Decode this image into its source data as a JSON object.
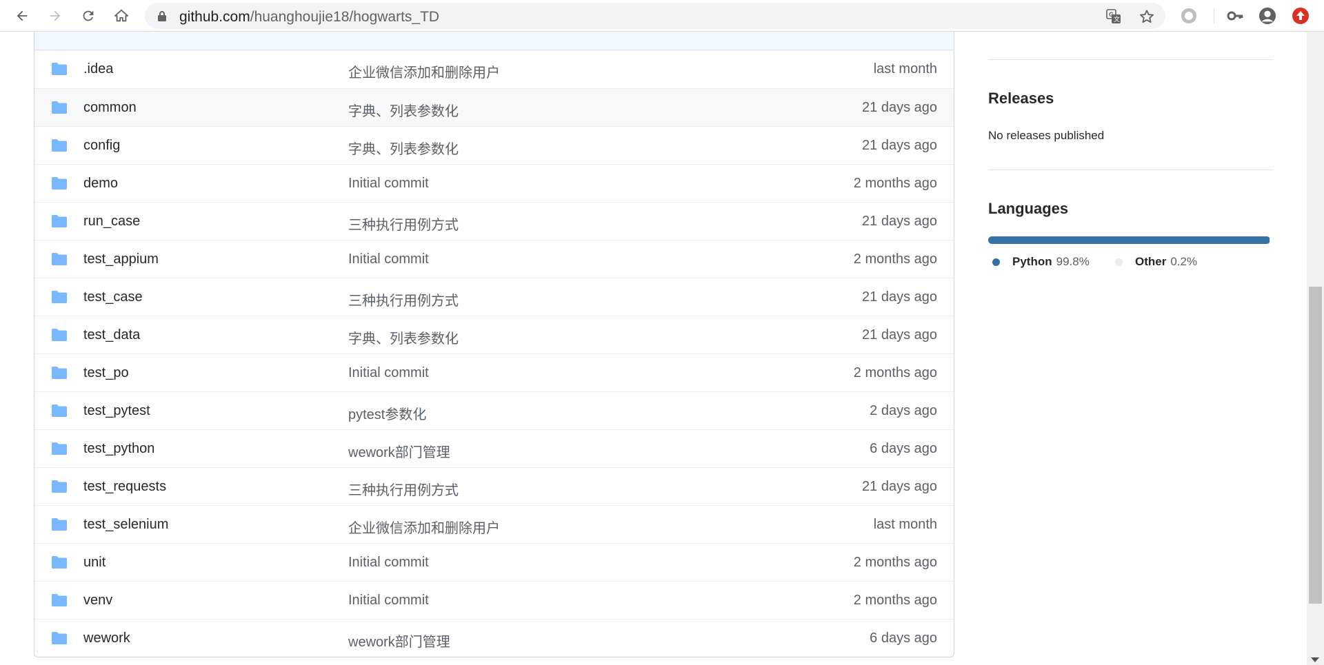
{
  "browser": {
    "url_host": "github.com",
    "url_path": "/huanghoujie18/hogwarts_TD",
    "icons": [
      "back-icon",
      "forward-icon",
      "reload-icon",
      "home-icon",
      "lock-icon",
      "translate-icon",
      "star-icon",
      "extension-icon",
      "key-icon",
      "profile-icon",
      "update-icon"
    ]
  },
  "files": [
    {
      "name": ".idea",
      "message": "企业微信添加和删除用户",
      "age": "last month"
    },
    {
      "name": "common",
      "message": "字典、列表参数化",
      "age": "21 days ago"
    },
    {
      "name": "config",
      "message": "字典、列表参数化",
      "age": "21 days ago"
    },
    {
      "name": "demo",
      "message": "Initial commit",
      "age": "2 months ago"
    },
    {
      "name": "run_case",
      "message": "三种执行用例方式",
      "age": "21 days ago"
    },
    {
      "name": "test_appium",
      "message": "Initial commit",
      "age": "2 months ago"
    },
    {
      "name": "test_case",
      "message": "三种执行用例方式",
      "age": "21 days ago"
    },
    {
      "name": "test_data",
      "message": "字典、列表参数化",
      "age": "21 days ago"
    },
    {
      "name": "test_po",
      "message": "Initial commit",
      "age": "2 months ago"
    },
    {
      "name": "test_pytest",
      "message": "pytest参数化",
      "age": "2 days ago"
    },
    {
      "name": "test_python",
      "message": "wework部门管理",
      "age": "6 days ago"
    },
    {
      "name": "test_requests",
      "message": "三种执行用例方式",
      "age": "21 days ago"
    },
    {
      "name": "test_selenium",
      "message": "企业微信添加和删除用户",
      "age": "last month"
    },
    {
      "name": "unit",
      "message": "Initial commit",
      "age": "2 months ago"
    },
    {
      "name": "venv",
      "message": "Initial commit",
      "age": "2 months ago"
    },
    {
      "name": "wework",
      "message": "wework部门管理",
      "age": "6 days ago"
    }
  ],
  "sidebar": {
    "releases_heading": "Releases",
    "releases_text": "No releases published",
    "languages_heading": "Languages",
    "languages": [
      {
        "name": "Python",
        "percent": "99.8%",
        "fraction": 0.998,
        "color": "#3572A5"
      },
      {
        "name": "Other",
        "percent": "0.2%",
        "fraction": 0.002,
        "color": "#ededed"
      }
    ]
  },
  "colors": {
    "folder": "#79b8ff",
    "link_text": "#24292e",
    "muted_text": "#586069",
    "update_badge": "#d93025"
  }
}
